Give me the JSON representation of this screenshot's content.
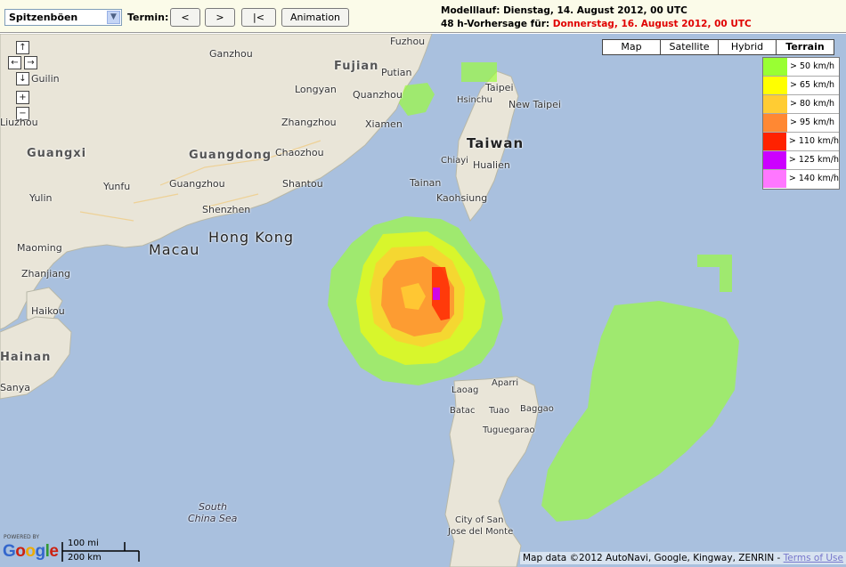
{
  "toolbar": {
    "layer_select": "Spitzenböen",
    "termin_label": "Termin:",
    "prev_label": "<",
    "next_label": ">",
    "first_label": "|<",
    "animation_label": "Animation",
    "model_run": "Modelllauf: Dienstag, 14. August 2012, 00 UTC",
    "forecast_prefix": "48 h-Vorhersage für: ",
    "forecast_date": "Donnerstag, 16. August 2012, 00 UTC"
  },
  "map_types": [
    {
      "label": "Map",
      "active": false
    },
    {
      "label": "Satellite",
      "active": false
    },
    {
      "label": "Hybrid",
      "active": false
    },
    {
      "label": "Terrain",
      "active": true
    }
  ],
  "legend": [
    {
      "label": "> 50 km/h",
      "color": "#99ff33"
    },
    {
      "label": "> 65 km/h",
      "color": "#ffff00"
    },
    {
      "label": "> 80 km/h",
      "color": "#ffcc33"
    },
    {
      "label": "> 95 km/h",
      "color": "#ff8833"
    },
    {
      "label": "> 110 km/h",
      "color": "#ff2200"
    },
    {
      "label": "> 125 km/h",
      "color": "#cc00ff"
    },
    {
      "label": "> 140 km/h",
      "color": "#ff77ff"
    }
  ],
  "places": {
    "fuzhou": "Fuzhou",
    "ganzhou": "Ganzhou",
    "fujian": "Fujian",
    "putian": "Putian",
    "guilin": "Guilin",
    "longyan": "Longyan",
    "quanzhou": "Quanzhou",
    "zhangzhou": "Zhangzhou",
    "xiamen": "Xiamen",
    "liuzhou": "Liuzhou",
    "guangxi": "Guangxi",
    "guangdong": "Guangdong",
    "chaozhou": "Chaozhou",
    "yunfu": "Yunfu",
    "guangzhou": "Guangzhou",
    "shantou": "Shantou",
    "yulin": "Yulin",
    "shenzhen": "Shenzhen",
    "hongkong": "Hong Kong",
    "macau": "Macau",
    "maoming": "Maoming",
    "zhanjiang": "Zhanjiang",
    "haikou": "Haikou",
    "hainan": "Hainan",
    "sanya": "Sanya",
    "taipei": "Taipei",
    "hsinchu": "Hsinchu",
    "newtaipei": "New Taipei",
    "taiwan": "Taiwan",
    "chiayi": "Chiayi",
    "hualien": "Hualien",
    "tainan": "Tainan",
    "kaohsiung": "Kaohsiung",
    "aparri": "Aparri",
    "laoag": "Laoag",
    "batac": "Batac",
    "tuao": "Tuao",
    "baggao": "Baggao",
    "tuguegarao": "Tuguegarao",
    "cityofsan": "City of San",
    "josedelmonte": "Jose del Monte",
    "southchinasea1": "South",
    "southchinasea2": "China Sea"
  },
  "scale": {
    "miles": "100 mi",
    "km": "200 km"
  },
  "google": {
    "powered": "POWERED BY",
    "logo": "Google"
  },
  "attribution": {
    "text": "Map data ©2012 AutoNavi, Google, Kingway, ZENRIN - ",
    "terms": "Terms of Use"
  }
}
